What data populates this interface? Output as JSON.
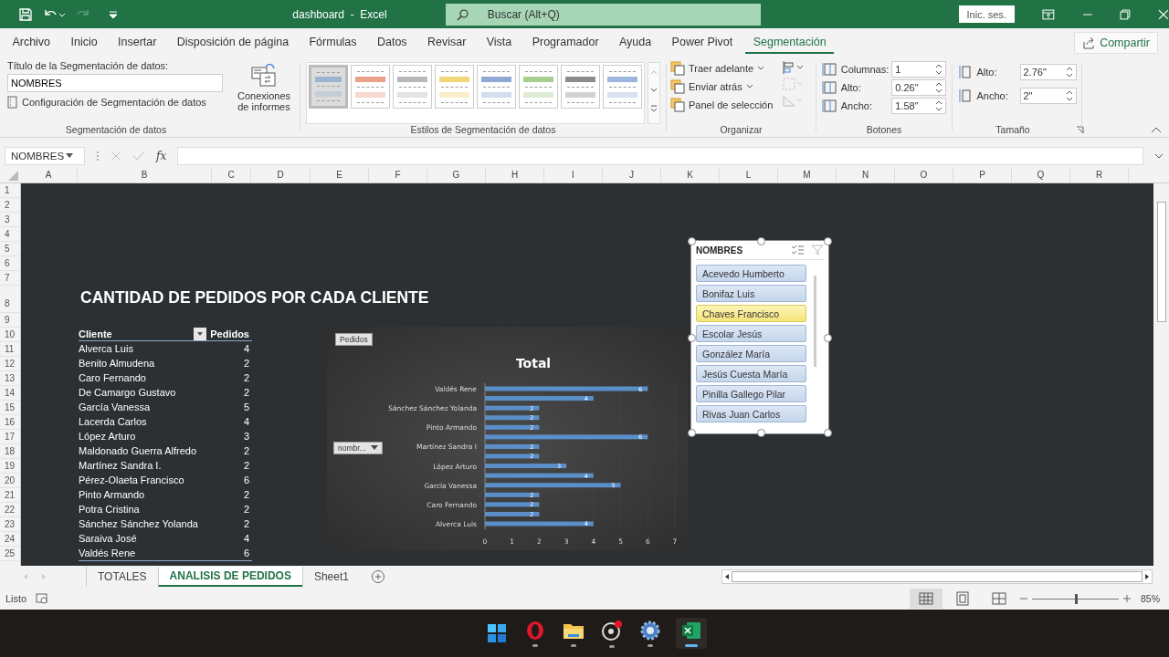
{
  "title_bar": {
    "title": "dashboard  -  Excel",
    "search": {
      "placeholder": "Buscar (Alt+Q)"
    },
    "sign_in": "Inic. ses."
  },
  "menu_tabs": [
    {
      "label": "Archivo",
      "selected": false
    },
    {
      "label": "Inicio",
      "selected": false
    },
    {
      "label": "Insertar",
      "selected": false
    },
    {
      "label": "Disposición de página",
      "selected": false
    },
    {
      "label": "Fórmulas",
      "selected": false
    },
    {
      "label": "Datos",
      "selected": false
    },
    {
      "label": "Revisar",
      "selected": false
    },
    {
      "label": "Vista",
      "selected": false
    },
    {
      "label": "Programador",
      "selected": false
    },
    {
      "label": "Ayuda",
      "selected": false
    },
    {
      "label": "Power Pivot",
      "selected": false
    },
    {
      "label": "Segmentación",
      "selected": true
    }
  ],
  "share": "Compartir",
  "ribbon": {
    "slicer_group": {
      "caption_label": "Título de la Segmentación de datos:",
      "caption_value": "NOMBRES",
      "settings": "Configuración de Segmentación de datos",
      "connections": "Conexiones de informes",
      "label": "Segmentación de datos"
    },
    "styles_group": {
      "label": "Estilos de Segmentación de datos",
      "styles": [
        {
          "color": "#9db3cf",
          "selected": true
        },
        {
          "color": "#e8a088",
          "selected": false
        },
        {
          "color": "#b8b8b8",
          "selected": false
        },
        {
          "color": "#f2d67a",
          "selected": false
        },
        {
          "color": "#8ea9d6",
          "selected": false
        },
        {
          "color": "#a8cf8e",
          "selected": false
        },
        {
          "color": "#8c8c8c",
          "selected": false
        },
        {
          "color": "#9fb6dc",
          "selected": false
        }
      ]
    },
    "arrange_group": {
      "label": "Organizar",
      "items": [
        "Traer adelante",
        "Enviar atrás",
        "Panel de selección"
      ]
    },
    "buttons_group": {
      "label": "Botones",
      "fields": [
        {
          "label": "Columnas:",
          "value": "1"
        },
        {
          "label": "Alto:",
          "value": "0.26\""
        },
        {
          "label": "Ancho:",
          "value": "1.58\""
        }
      ]
    },
    "size_group": {
      "label": "Tamaño",
      "fields": [
        {
          "label": "Alto:",
          "value": "2.76\""
        },
        {
          "label": "Ancho:",
          "value": "2\""
        }
      ]
    }
  },
  "formula_bar": {
    "name_box": "NOMBRES",
    "fx": "fx"
  },
  "columns": [
    "A",
    "B",
    "C",
    "D",
    "E",
    "F",
    "G",
    "H",
    "I",
    "J",
    "K",
    "L",
    "M",
    "N",
    "O",
    "P",
    "Q",
    "R"
  ],
  "rows": [
    "1",
    "2",
    "3",
    "4",
    "5",
    "6",
    "7",
    "8",
    "9",
    "10",
    "11",
    "12",
    "13",
    "14",
    "15",
    "16",
    "17",
    "18",
    "19",
    "20",
    "21",
    "22",
    "23",
    "24",
    "25"
  ],
  "sheet": {
    "heading": "CANTIDAD DE PEDIDOS POR CADA CLIENTE",
    "pivot": {
      "columns": [
        "Cliente",
        "Pedidos"
      ],
      "rows": [
        {
          "cliente": "Alverca Luis",
          "pedidos": "4"
        },
        {
          "cliente": "Benito Almudena",
          "pedidos": "2"
        },
        {
          "cliente": "Caro Fernando",
          "pedidos": "2"
        },
        {
          "cliente": "De Camargo Gustavo",
          "pedidos": "2"
        },
        {
          "cliente": "García Vanessa",
          "pedidos": "5"
        },
        {
          "cliente": "Lacerda Carlos",
          "pedidos": "4"
        },
        {
          "cliente": "López Arturo",
          "pedidos": "3"
        },
        {
          "cliente": "Maldonado Guerra Alfredo",
          "pedidos": "2"
        },
        {
          "cliente": "Martínez Sandra I.",
          "pedidos": "2"
        },
        {
          "cliente": "Pérez-Olaeta Francisco",
          "pedidos": "6"
        },
        {
          "cliente": "Pinto Armando",
          "pedidos": "2"
        },
        {
          "cliente": "Potra Cristina",
          "pedidos": "2"
        },
        {
          "cliente": "Sánchez Sánchez Yolanda",
          "pedidos": "2"
        },
        {
          "cliente": "Saraiva José",
          "pedidos": "4"
        },
        {
          "cliente": "Valdés Rene",
          "pedidos": "6"
        }
      ]
    },
    "chart": {
      "value_button": "Pedidos",
      "axis_button": "nombr...",
      "chart_data": {
        "type": "bar",
        "orientation": "horizontal",
        "title": "Total",
        "categories": [
          "Valdés Rene",
          null,
          "Sánchez Sánchez Yolanda",
          null,
          "Pinto Armando",
          null,
          "Martínez Sandra I",
          null,
          "López Arturo",
          null,
          "García Vanessa",
          null,
          "Caro Fernando",
          null,
          "Alverca Luis"
        ],
        "values": [
          6,
          4,
          2,
          2,
          2,
          6,
          2,
          2,
          3,
          4,
          5,
          2,
          2,
          2,
          4
        ],
        "xlim": [
          0,
          7
        ],
        "xticks": [
          0,
          1,
          2,
          3,
          4,
          5,
          6,
          7
        ],
        "data_labels": true
      }
    },
    "slicer": {
      "title": "NOMBRES",
      "items": [
        {
          "label": "Acevedo Humberto",
          "hovered": false
        },
        {
          "label": "Bonifaz Luis",
          "hovered": false
        },
        {
          "label": "Chaves Francisco",
          "hovered": true
        },
        {
          "label": "Escolar Jesús",
          "hovered": false
        },
        {
          "label": "González María",
          "hovered": false
        },
        {
          "label": "Jesús Cuesta María",
          "hovered": false
        },
        {
          "label": "Pinilla Gallego Pilar",
          "hovered": false
        },
        {
          "label": "Rivas Juan Carlos",
          "hovered": false
        }
      ]
    }
  },
  "sheet_tabs": [
    {
      "label": "TOTALES",
      "selected": false
    },
    {
      "label": "ANALISIS DE PEDIDOS",
      "selected": true
    },
    {
      "label": "Sheet1",
      "selected": false
    }
  ],
  "status_bar": {
    "status": "Listo",
    "zoom": "85%",
    "zoom_level": {
      "level": 0.5
    }
  }
}
